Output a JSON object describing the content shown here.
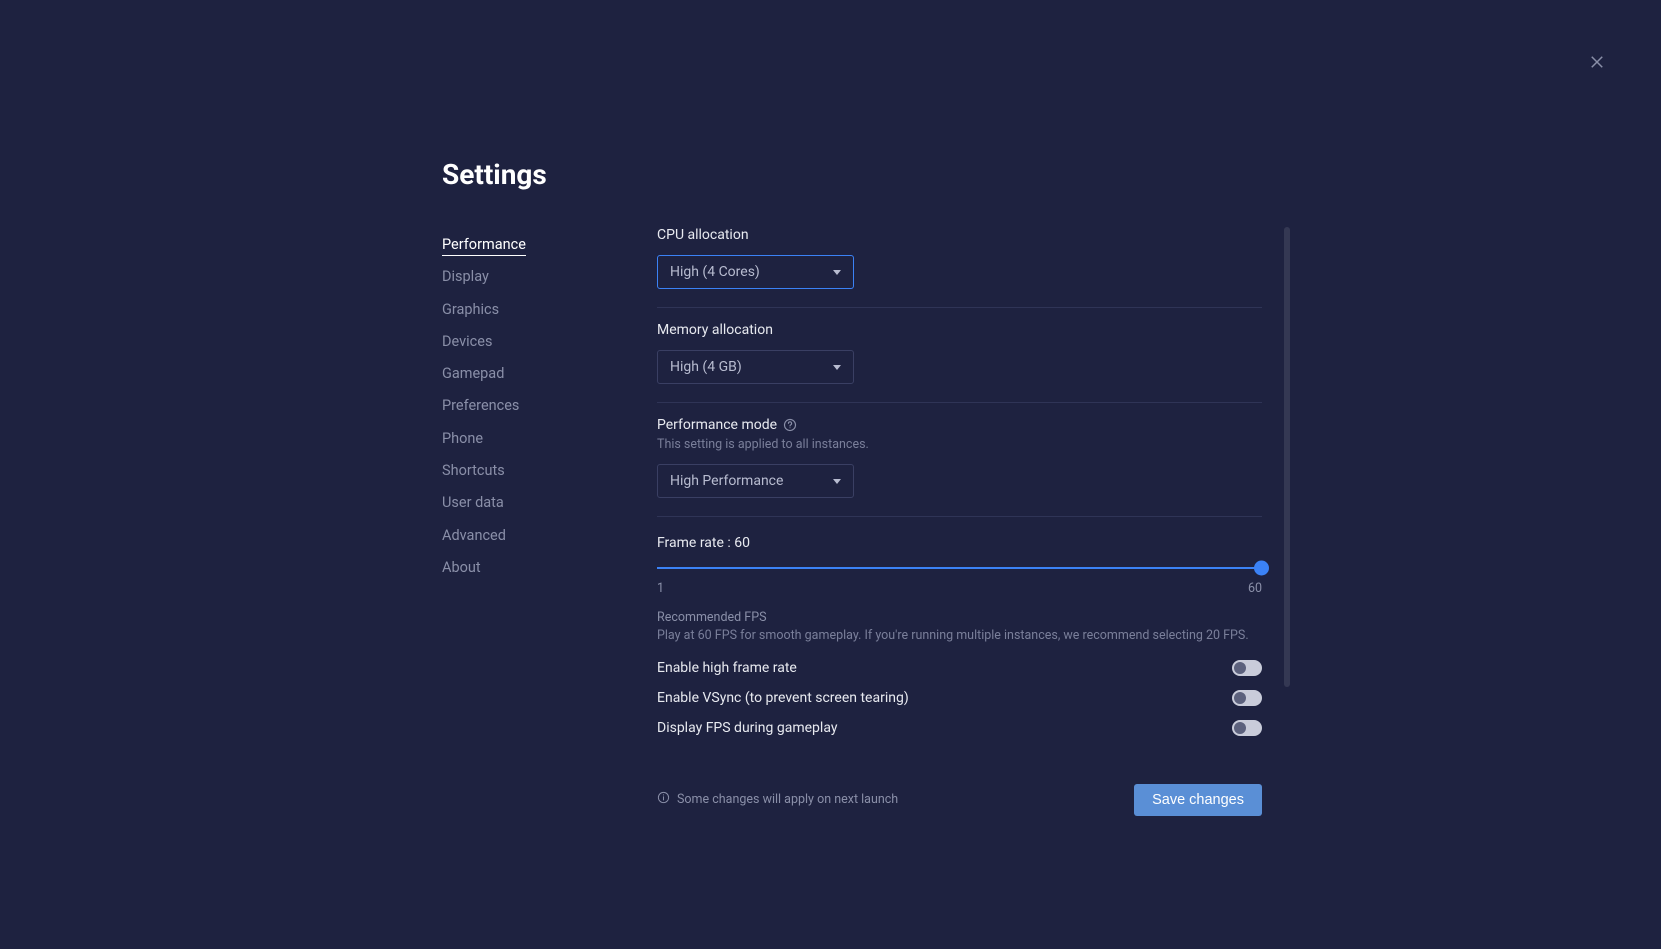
{
  "page_title": "Settings",
  "sidebar": {
    "items": [
      {
        "label": "Performance",
        "active": true
      },
      {
        "label": "Display",
        "active": false
      },
      {
        "label": "Graphics",
        "active": false
      },
      {
        "label": "Devices",
        "active": false
      },
      {
        "label": "Gamepad",
        "active": false
      },
      {
        "label": "Preferences",
        "active": false
      },
      {
        "label": "Phone",
        "active": false
      },
      {
        "label": "Shortcuts",
        "active": false
      },
      {
        "label": "User data",
        "active": false
      },
      {
        "label": "Advanced",
        "active": false
      },
      {
        "label": "About",
        "active": false
      }
    ]
  },
  "cpu": {
    "label": "CPU allocation",
    "value": "High (4 Cores)"
  },
  "memory": {
    "label": "Memory allocation",
    "value": "High (4 GB)"
  },
  "perfmode": {
    "label": "Performance mode",
    "subtext": "This setting is applied to all instances.",
    "value": "High Performance"
  },
  "framerate": {
    "label_prefix": "Frame rate : ",
    "value": "60",
    "min": "1",
    "max": "60"
  },
  "recommend": {
    "title": "Recommended FPS",
    "text": "Play at 60 FPS for smooth gameplay. If you're running multiple instances, we recommend selecting 20 FPS."
  },
  "toggles": {
    "high_frame": "Enable high frame rate",
    "vsync": "Enable VSync (to prevent screen tearing)",
    "display_fps": "Display FPS during gameplay"
  },
  "footer": {
    "note": "Some changes will apply on next launch",
    "save": "Save changes"
  }
}
